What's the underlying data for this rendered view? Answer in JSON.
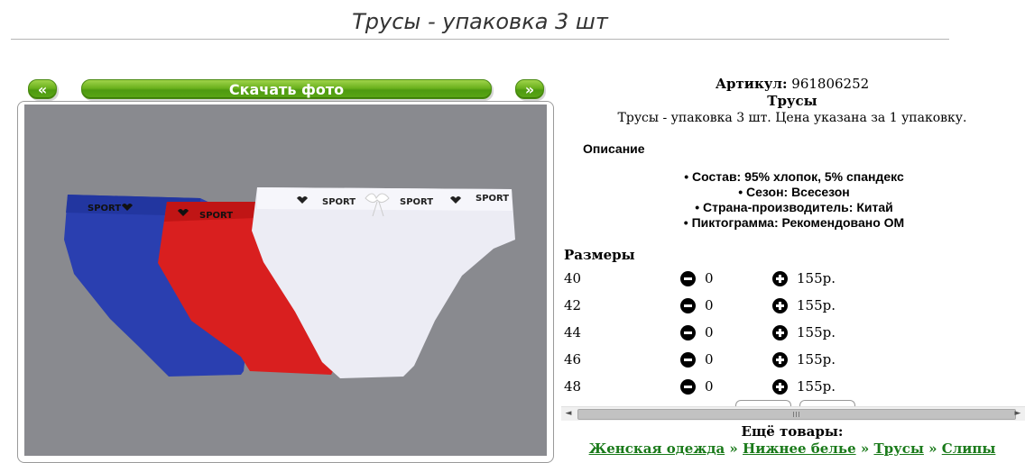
{
  "page": {
    "title": "Трусы - упаковка 3 шт"
  },
  "gallery": {
    "prev_label": "«",
    "download_label": "Скачать фото",
    "next_label": "»"
  },
  "photo": {
    "band_text": "SPORT",
    "colors": {
      "background": "#898a8f",
      "blue": "#2a3fb0",
      "red": "#d91f1f",
      "white": "#ececf4"
    }
  },
  "product": {
    "sku_label": "Артикул:",
    "sku_value": "961806252",
    "name": "Трусы",
    "summary": "Трусы - упаковка 3 шт. Цена указана за 1 упаковку."
  },
  "description": {
    "heading": "Описание",
    "items": [
      "• Состав: 95% хлопок, 5% спандекс",
      "• Сезон: Всесезон",
      "• Страна-производитель: Китай",
      "• Пиктограмма: Рекомендовано ОМ"
    ]
  },
  "sizes": {
    "heading": "Размеры",
    "rows": [
      {
        "size": "40",
        "qty": "0",
        "price": "155р."
      },
      {
        "size": "42",
        "qty": "0",
        "price": "155р."
      },
      {
        "size": "44",
        "qty": "0",
        "price": "155р."
      },
      {
        "size": "46",
        "qty": "0",
        "price": "155р."
      },
      {
        "size": "48",
        "qty": "0",
        "price": "155р."
      }
    ]
  },
  "scrollbar": {
    "left_arrow": "◄",
    "right_arrow": "►"
  },
  "more": {
    "heading": "Ещё товары:",
    "crumbs": [
      "Женская одежда",
      "Нижнее белье",
      "Трусы",
      "Слипы"
    ],
    "separator": "»"
  },
  "theme": {
    "accent_green": "#6ab11d",
    "link_green": "#1a7a1a"
  }
}
